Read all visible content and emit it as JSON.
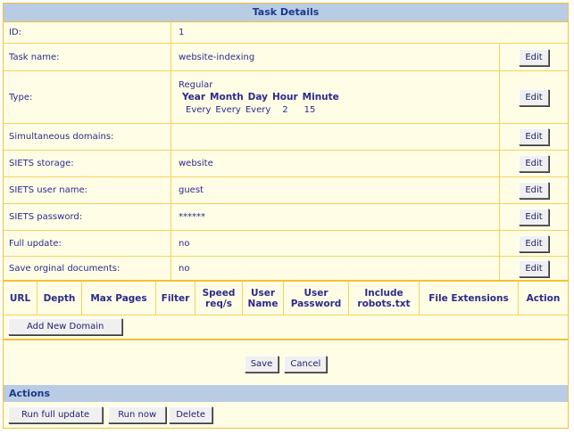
{
  "title": "Task Details",
  "rows": {
    "id": {
      "label": "ID:",
      "value": "1"
    },
    "task_name": {
      "label": "Task name:",
      "value": "website-indexing",
      "edit": "Edit"
    },
    "type": {
      "label": "Type:",
      "value": "Regular",
      "edit": "Edit",
      "schedule_headers": [
        "Year",
        "Month",
        "Day",
        "Hour",
        "Minute"
      ],
      "schedule_values": [
        "Every",
        "Every",
        "Every",
        "2",
        "15"
      ]
    },
    "simultaneous_domains": {
      "label": "Simultaneous domains:",
      "value": "",
      "edit": "Edit"
    },
    "storage": {
      "label": "SIETS storage:",
      "value": "website",
      "edit": "Edit"
    },
    "user_name": {
      "label": "SIETS user name:",
      "value": "guest",
      "edit": "Edit"
    },
    "password": {
      "label": "SIETS password:",
      "value": "******",
      "edit": "Edit"
    },
    "full_update": {
      "label": "Full update:",
      "value": "no",
      "edit": "Edit"
    },
    "save_docs": {
      "label": "Save orginal documents:",
      "value": "no",
      "edit": "Edit"
    }
  },
  "domain_table": {
    "headers": [
      "URL",
      "Depth",
      "Max Pages",
      "Filter",
      "Speed req/s",
      "User Name",
      "User Password",
      "Include robots.txt",
      "File Extensions",
      "Action"
    ]
  },
  "add_domain_label": "Add New Domain",
  "save_label": "Save",
  "cancel_label": "Cancel",
  "actions": {
    "header": "Actions",
    "run_full_update": "Run full update",
    "run_now": "Run now",
    "delete": "Delete"
  }
}
